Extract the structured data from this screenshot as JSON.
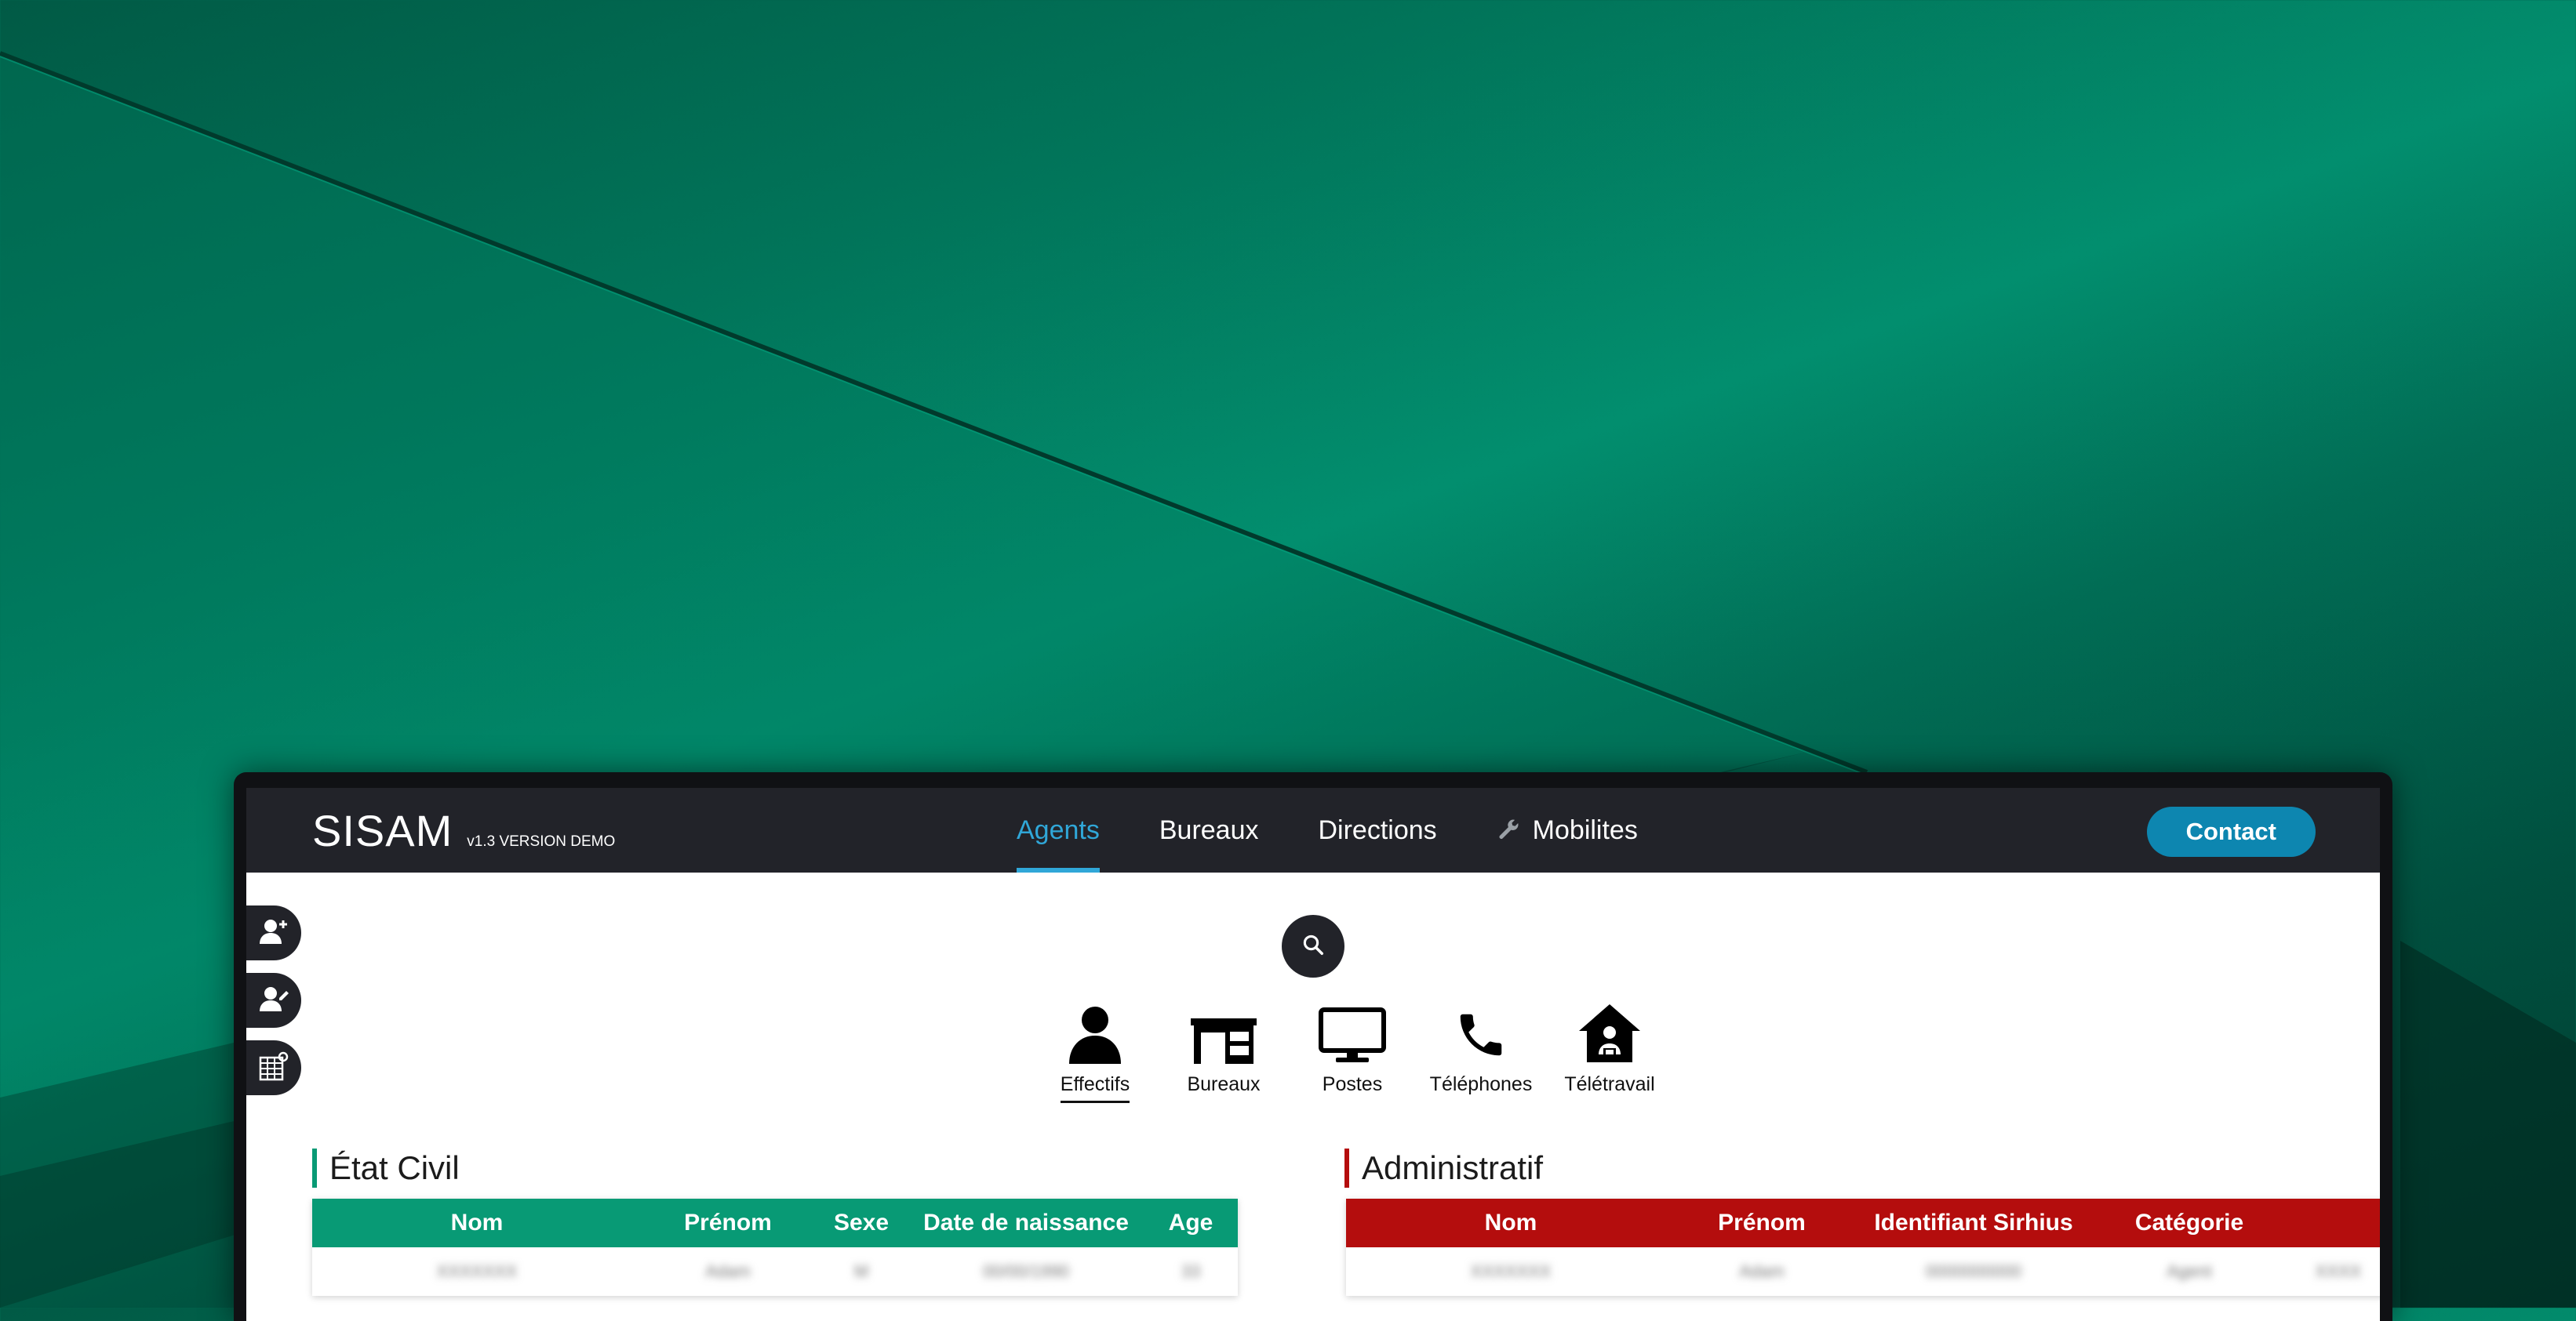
{
  "app": {
    "name": "SISAM",
    "version": "v1.3 VERSION DEMO"
  },
  "nav": {
    "links": [
      {
        "label": "Agents",
        "active": true
      },
      {
        "label": "Bureaux"
      },
      {
        "label": "Directions"
      },
      {
        "label": "Mobilites",
        "icon": "wrench-icon"
      }
    ],
    "contact_label": "Contact"
  },
  "side_tools": [
    {
      "icon": "add-user-icon"
    },
    {
      "icon": "edit-user-icon"
    },
    {
      "icon": "spreadsheet-icon"
    }
  ],
  "search": {
    "icon": "search-icon"
  },
  "categories": [
    {
      "label": "Effectifs",
      "icon": "person-icon",
      "active": true
    },
    {
      "label": "Bureaux",
      "icon": "desk-icon"
    },
    {
      "label": "Postes",
      "icon": "monitor-icon"
    },
    {
      "label": "Téléphones",
      "icon": "phone-icon"
    },
    {
      "label": "Télétravail",
      "icon": "home-work-icon"
    }
  ],
  "etat_civil": {
    "title": "État Civil",
    "columns": [
      "Nom",
      "Prénom",
      "Sexe",
      "Date de naissance",
      "Age"
    ],
    "rows": [
      [
        "XXXXXXX",
        "Adam",
        "M",
        "00/00/1990",
        "33"
      ]
    ]
  },
  "administratif": {
    "title": "Administratif",
    "columns": [
      "Nom",
      "Prénom",
      "Identifiant Sirhius",
      "Catégorie",
      ""
    ],
    "rows": [
      [
        "XXXXXXX",
        "Adam",
        "0000000000",
        "Agent",
        "XXXX"
      ]
    ]
  },
  "colors": {
    "accent_blue": "#30a7d8",
    "contact_blue": "#0d86b0",
    "green": "#089a75",
    "red": "#b40d0d",
    "navbar": "#222329"
  }
}
